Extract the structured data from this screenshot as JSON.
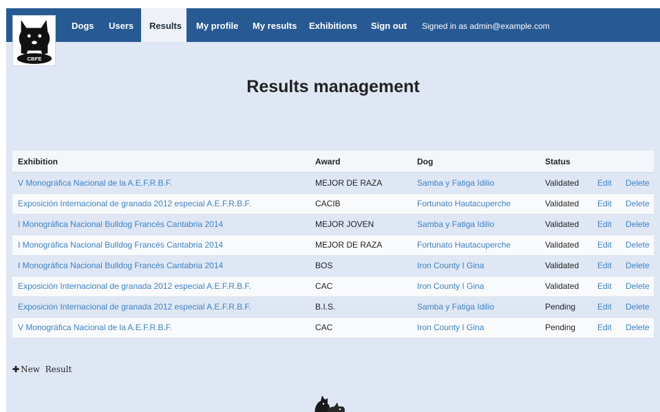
{
  "nav": {
    "items": [
      {
        "label": "Dogs",
        "active": false
      },
      {
        "label": "Users",
        "active": false
      },
      {
        "label": "Results",
        "active": true
      },
      {
        "label": "My profile",
        "active": false
      },
      {
        "label": "My results",
        "active": false
      },
      {
        "label": "Exhibitions",
        "active": false
      },
      {
        "label": "Sign out",
        "active": false
      }
    ],
    "signed_in": "Signed in as admin@example.com"
  },
  "logo": {
    "text": "CBFE"
  },
  "page": {
    "title": "Results management"
  },
  "table": {
    "headers": {
      "exhibition": "Exhibition",
      "award": "Award",
      "dog": "Dog",
      "status": "Status"
    },
    "rows": [
      {
        "exhibition": "V Monográfica Nacional de la A.E.F.R.B.F.",
        "award": "MEJOR DE RAZA",
        "dog": "Samba y Fatiga Idilio",
        "status": "Validated",
        "edit": "Edit",
        "delete": "Delete"
      },
      {
        "exhibition": "Exposición Internacional de granada 2012 especial A.E.F.R.B.F.",
        "award": "CACIB",
        "dog": "Fortunato Hautacuperche",
        "status": "Validated",
        "edit": "Edit",
        "delete": "Delete"
      },
      {
        "exhibition": "I Monográfica Nacional Bulldog Francés Cantabria 2014",
        "award": "MEJOR JOVEN",
        "dog": "Samba y Fatiga Idilio",
        "status": "Validated",
        "edit": "Edit",
        "delete": "Delete"
      },
      {
        "exhibition": "I Monográfica Nacional Bulldog Francés Cantabria 2014",
        "award": "MEJOR DE RAZA",
        "dog": "Fortunato Hautacuperche",
        "status": "Validated",
        "edit": "Edit",
        "delete": "Delete"
      },
      {
        "exhibition": "I Monográfica Nacional Bulldog Francés Cantabria 2014",
        "award": "BOS",
        "dog": "Iron County I Gina",
        "status": "Validated",
        "edit": "Edit",
        "delete": "Delete"
      },
      {
        "exhibition": "Exposición Internacional de granada 2012 especial A.E.F.R.B.F.",
        "award": "CAC",
        "dog": "Iron County I Gina",
        "status": "Validated",
        "edit": "Edit",
        "delete": "Delete"
      },
      {
        "exhibition": "Exposición Internacional de granada 2012 especial A.E.F.R.B.F.",
        "award": "B.I.S.",
        "dog": "Samba y Fatiga Idilio",
        "status": "Pending",
        "edit": "Edit",
        "delete": "Delete"
      },
      {
        "exhibition": "V Monográfica Nacional de la A.E.F.R.B.F.",
        "award": "CAC",
        "dog": "Iron County I Gina",
        "status": "Pending",
        "edit": "Edit",
        "delete": "Delete"
      }
    ]
  },
  "actions": {
    "new_icon": "plus-icon",
    "new_label": "New",
    "new_suffix": "Result"
  },
  "colors": {
    "navbar": "#275a92",
    "background": "#dfe7f5",
    "link": "#3d82c4"
  }
}
